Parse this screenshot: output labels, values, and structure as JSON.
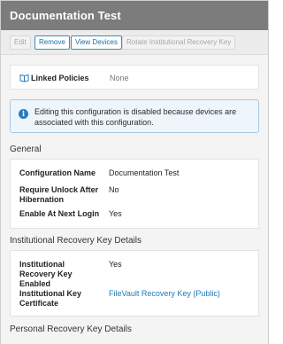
{
  "header": {
    "title": "Documentation Test"
  },
  "toolbar": {
    "edit": "Edit",
    "remove": "Remove",
    "view_devices": "View Devices",
    "rotate": "Rotate Institutional Recovery Key"
  },
  "linked_policies": {
    "label": "Linked Policies",
    "value": "None",
    "icon": "book-icon"
  },
  "info": {
    "icon": "info-icon",
    "text": "Editing this configuration is disabled because devices are associated with this configuration."
  },
  "general": {
    "title": "General",
    "rows": [
      {
        "label": "Configuration Name",
        "value": "Documentation Test"
      },
      {
        "label": "Require Unlock After Hibernation",
        "value": "No"
      },
      {
        "label": "Enable At Next Login",
        "value": "Yes"
      }
    ]
  },
  "institutional": {
    "title": "Institutional Recovery Key Details",
    "rows": [
      {
        "label": "Institutional Recovery Key Enabled",
        "value": "Yes"
      },
      {
        "label": "Institutional Key Certificate",
        "value": "FileVault Recovery Key (Public)"
      }
    ]
  },
  "personal": {
    "title": "Personal Recovery Key Details"
  },
  "colors": {
    "header_bg": "#7c7c7c",
    "accent": "#1a7ab8",
    "info_bg": "#eef5fb"
  }
}
